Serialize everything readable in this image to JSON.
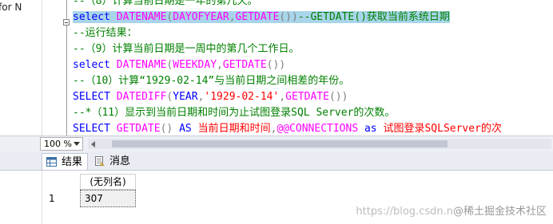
{
  "left_strip": {
    "cut_text": "for N"
  },
  "editor": {
    "lines": [
      {
        "parts": [
          {
            "t": "--（8）计算当前日期是一年的第几天。",
            "c": "c-com"
          }
        ]
      },
      {
        "highlight": true,
        "parts": [
          {
            "t": "select ",
            "c": "c-kw"
          },
          {
            "t": "DATENAME",
            "c": "c-fn"
          },
          {
            "t": "(",
            "c": "c-pun"
          },
          {
            "t": "DAYOFYEAR",
            "c": "c-fn"
          },
          {
            "t": ",",
            "c": "c-pun"
          },
          {
            "t": "GETDATE",
            "c": "c-fn"
          },
          {
            "t": "())",
            "c": "c-pun"
          },
          {
            "t": "--GETDATE()获取当前系统日期",
            "c": "c-com"
          }
        ]
      },
      {
        "parts": [
          {
            "t": "--运行结果：",
            "c": "c-com"
          }
        ]
      },
      {
        "parts": [
          {
            "t": "--（9）计算当前日期是一周中的第几个工作日。",
            "c": "c-com"
          }
        ]
      },
      {
        "parts": [
          {
            "t": "select ",
            "c": "c-kw"
          },
          {
            "t": "DATENAME",
            "c": "c-fn"
          },
          {
            "t": "(",
            "c": "c-pun"
          },
          {
            "t": "WEEKDAY",
            "c": "c-fn"
          },
          {
            "t": ",",
            "c": "c-pun"
          },
          {
            "t": "GETDATE",
            "c": "c-fn"
          },
          {
            "t": "())",
            "c": "c-pun"
          }
        ]
      },
      {
        "parts": [
          {
            "t": "--（10）计算“1929-02-14”与当前日期之间相差的年份。",
            "c": "c-com"
          }
        ]
      },
      {
        "parts": [
          {
            "t": "SELECT ",
            "c": "c-kw"
          },
          {
            "t": "DATEDIFF",
            "c": "c-fn"
          },
          {
            "t": "(",
            "c": "c-pun"
          },
          {
            "t": "YEAR",
            "c": "c-kw"
          },
          {
            "t": ",",
            "c": "c-pun"
          },
          {
            "t": "'1929-02-14'",
            "c": "c-str"
          },
          {
            "t": ",",
            "c": "c-pun"
          },
          {
            "t": "GETDATE",
            "c": "c-fn"
          },
          {
            "t": "())",
            "c": "c-pun"
          }
        ]
      },
      {
        "parts": [
          {
            "t": "--*（11）显示到当前日期和时间为止试图登录SQL Server的次数。",
            "c": "c-com"
          }
        ]
      },
      {
        "parts": [
          {
            "t": "SELECT ",
            "c": "c-kw"
          },
          {
            "t": "GETDATE",
            "c": "c-fn"
          },
          {
            "t": "() ",
            "c": "c-pun"
          },
          {
            "t": "AS ",
            "c": "c-kw"
          },
          {
            "t": "当前日期和时间",
            "c": "c-alias"
          },
          {
            "t": ",",
            "c": "c-pun"
          },
          {
            "t": "@@CONNECTIONS ",
            "c": "c-var"
          },
          {
            "t": "as ",
            "c": "c-kw"
          },
          {
            "t": "试图登录SQLServer的次",
            "c": "c-alias"
          }
        ]
      }
    ]
  },
  "zoom": {
    "value": "100 %"
  },
  "tabs": {
    "results": "结果",
    "messages": "消息"
  },
  "grid": {
    "column_header": "(无列名)",
    "rows": [
      {
        "num": "1",
        "value": "307"
      }
    ]
  },
  "watermark": {
    "site": "https://blog.csdn.n",
    "brand": "@稀土掘金技术社区"
  },
  "colors": {
    "highlight": "#a8d5ea",
    "keyword": "#0000ff",
    "function": "#ff00ff",
    "comment": "#008000",
    "string": "#ff0000"
  }
}
